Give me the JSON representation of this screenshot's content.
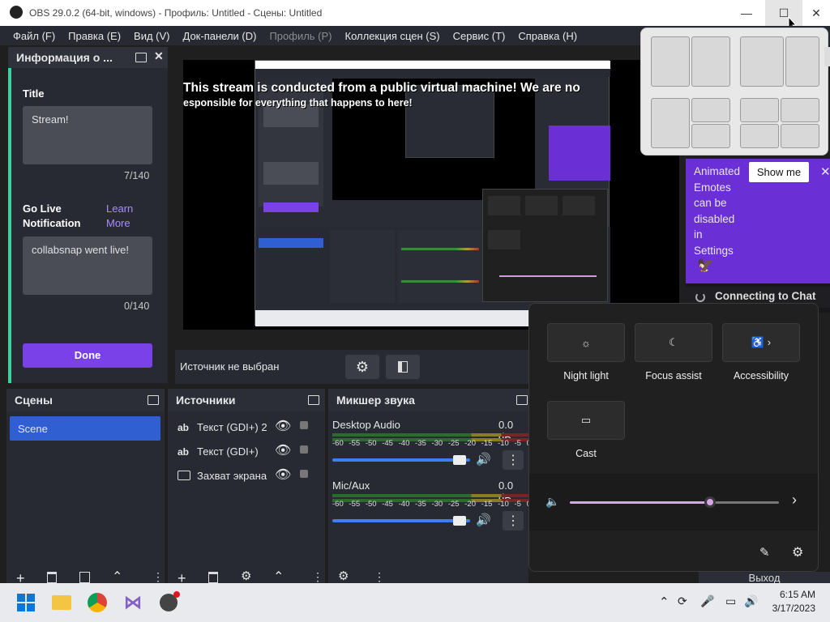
{
  "titlebar": {
    "title": "OBS 29.0.2 (64-bit, windows) - Профиль: Untitled - Сцены: Untitled",
    "minimize": "—",
    "maximize": "☐",
    "close": "✕"
  },
  "menu": {
    "file": "Файл (F)",
    "edit": "Правка (E)",
    "view": "Вид (V)",
    "docks": "Док-панели (D)",
    "profile": "Профиль (P)",
    "collection": "Коллекция сцен (S)",
    "tools": "Сервис (T)",
    "help": "Справка (H)"
  },
  "info_dock": {
    "title": "Информация о ...",
    "title_label": "Title",
    "title_value": "Stream!",
    "title_counter": "7/140",
    "golive_label_1": "Go Live",
    "golive_label_2": "Notification",
    "learn_more_1": "Learn",
    "learn_more_2": "More",
    "notification_value": "collabsnap went live!",
    "notification_counter": "0/140",
    "done": "Done"
  },
  "preview": {
    "overlay_line1": "This stream is conducted from a public virtual machine! We are no",
    "overlay_line2": "esponsible for everything that happens to here!"
  },
  "source_bar": {
    "no_source": "Источник не выбран"
  },
  "scenes": {
    "title": "Сцены",
    "items": [
      "Scene"
    ]
  },
  "sources": {
    "title": "Источники",
    "items": [
      {
        "name": "Текст (GDI+) 2",
        "icon": "text-icon"
      },
      {
        "name": "Текст (GDI+)",
        "icon": "text-icon"
      },
      {
        "name": "Захват экрана",
        "icon": "monitor-icon"
      }
    ]
  },
  "mixer": {
    "title": "Микшер звука",
    "channels": [
      {
        "name": "Desktop Audio",
        "db": "0.0 dB",
        "volume": 0.97
      },
      {
        "name": "Mic/Aux",
        "db": "0.0 dB",
        "volume": 0.97
      }
    ],
    "scale": [
      "-60",
      "-55",
      "-50",
      "-45",
      "-40",
      "-35",
      "-30",
      "-25",
      "-20",
      "-15",
      "-10",
      "-5",
      "0"
    ]
  },
  "chat": {
    "emote_text": [
      "Animated",
      "Emotes",
      "can be",
      "disabled",
      "in",
      "Settings"
    ],
    "show_me": "Show me",
    "connecting": "Connecting to Chat"
  },
  "quick_settings": {
    "tiles": [
      {
        "label": "Night light",
        "icon": "night-light-icon"
      },
      {
        "label": "Focus assist",
        "icon": "focus-assist-icon"
      },
      {
        "label": "Accessibility",
        "icon": "accessibility-icon"
      },
      {
        "label": "Cast",
        "icon": "cast-icon"
      }
    ],
    "volume": 0.67
  },
  "partial": {
    "exit": "Выход"
  },
  "taskbar": {
    "time": "6:15 AM",
    "date": "3/17/2023"
  },
  "colors": {
    "accent_purple": "#7a41e8",
    "scene_selected": "#2f5fd0",
    "dock_bg": "#272a33"
  }
}
